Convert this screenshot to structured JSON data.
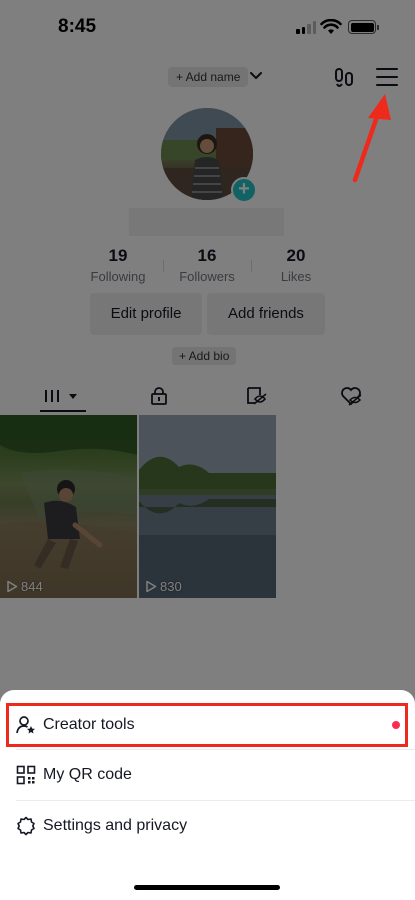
{
  "status_bar": {
    "time": "8:45"
  },
  "header": {
    "add_name": "+ Add name"
  },
  "stats": [
    {
      "value": "19",
      "label": "Following"
    },
    {
      "value": "16",
      "label": "Followers"
    },
    {
      "value": "20",
      "label": "Likes"
    }
  ],
  "buttons": {
    "edit_profile": "Edit profile",
    "add_friends": "Add friends"
  },
  "add_bio": "+ Add bio",
  "videos": [
    {
      "views": "844"
    },
    {
      "views": "830"
    }
  ],
  "menu": {
    "items": [
      {
        "label": "Creator tools",
        "icon": "person-star-icon",
        "has_notification": true
      },
      {
        "label": "My QR code",
        "icon": "qr-code-icon"
      },
      {
        "label": "Settings and privacy",
        "icon": "gear-icon"
      }
    ]
  },
  "colors": {
    "accent_teal": "#20c4cb",
    "notification_red": "#fe2c55",
    "annotation_red": "#ee2a1d"
  }
}
